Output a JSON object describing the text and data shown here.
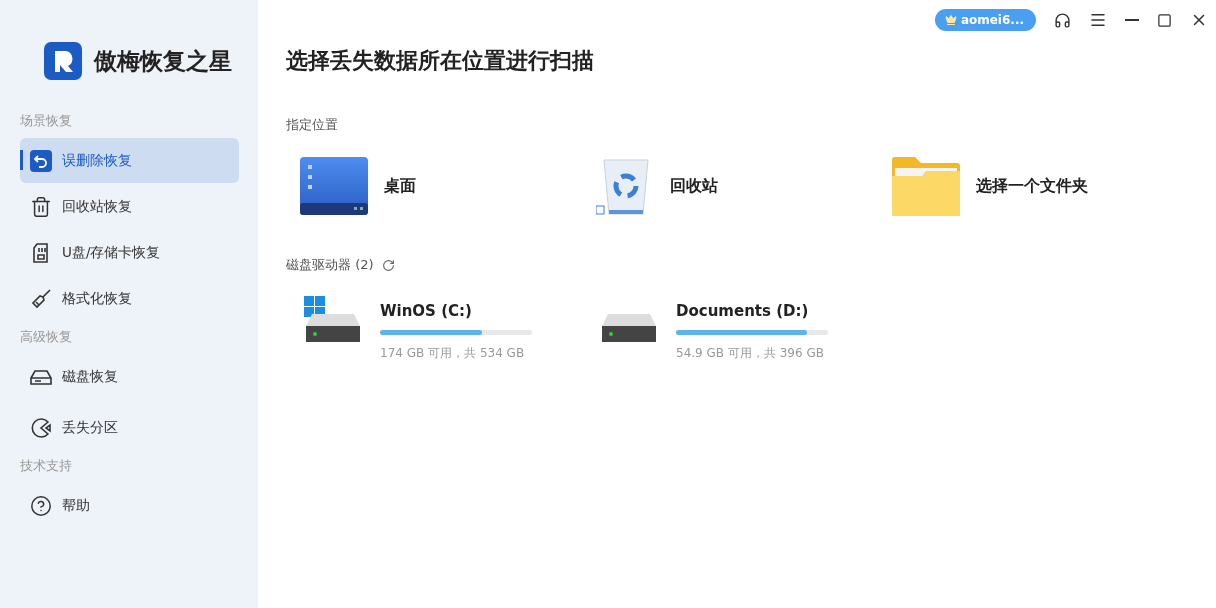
{
  "app": {
    "name": "傲梅恢复之星"
  },
  "sidebar": {
    "sections": [
      {
        "title": "场景恢复",
        "items": [
          {
            "label": "误删除恢复",
            "kind": "undo",
            "selected": true
          },
          {
            "label": "回收站恢复",
            "kind": "trash",
            "selected": false
          },
          {
            "label": "U盘/存储卡恢复",
            "kind": "sdcard",
            "selected": false
          },
          {
            "label": "格式化恢复",
            "kind": "broom",
            "selected": false
          }
        ]
      },
      {
        "title": "高级恢复",
        "items": [
          {
            "label": "磁盘恢复",
            "kind": "disk",
            "selected": false
          },
          {
            "label": "丢失分区",
            "kind": "partition",
            "selected": false
          }
        ]
      },
      {
        "title": "技术支持",
        "items": [
          {
            "label": "帮助",
            "kind": "help",
            "selected": false
          }
        ]
      }
    ]
  },
  "topbar": {
    "account": "aomei6..."
  },
  "main": {
    "title": "选择丢失数据所在位置进行扫描",
    "locations_heading": "指定位置",
    "locations": [
      {
        "label": "桌面",
        "kind": "desktop"
      },
      {
        "label": "回收站",
        "kind": "recycle"
      },
      {
        "label": "选择一个文件夹",
        "kind": "folder"
      }
    ],
    "drives_heading": "磁盘驱动器 (2)",
    "drives": [
      {
        "name": "WinOS (C:)",
        "kind": "system",
        "level": 0.67,
        "usage": "174 GB 可用，共 534 GB"
      },
      {
        "name": "Documents (D:)",
        "kind": "data",
        "level": 0.86,
        "usage": "54.9 GB 可用，共 396 GB"
      }
    ]
  }
}
